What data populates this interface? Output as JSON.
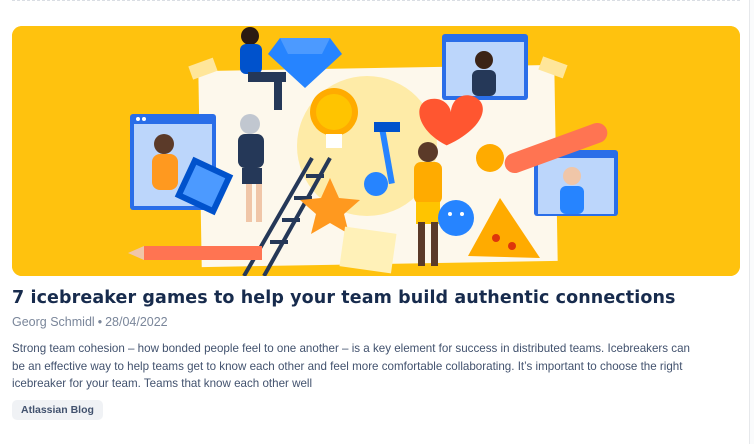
{
  "article": {
    "title": "7 icebreaker games to help your team build authentic connections",
    "author": "Georg Schmidl",
    "separator": "•",
    "date": "28/04/2022",
    "excerpt": "Strong team cohesion – how bonded people feel to one another – is a key element for success in distributed teams. Icebreakers can be an effective way to help teams get to know each other and feel more comfortable collaborating. It’s important to choose the right icebreaker for your team. Teams that know each other well",
    "tag": "Atlassian Blog"
  },
  "hero": {
    "image_subject": "illustration-team-icebreaker",
    "background_color": "#ffc20e"
  },
  "colors": {
    "title": "#172b4d",
    "meta": "#7a869a",
    "excerpt": "#42526e",
    "tag_bg": "#f0f2f5"
  }
}
